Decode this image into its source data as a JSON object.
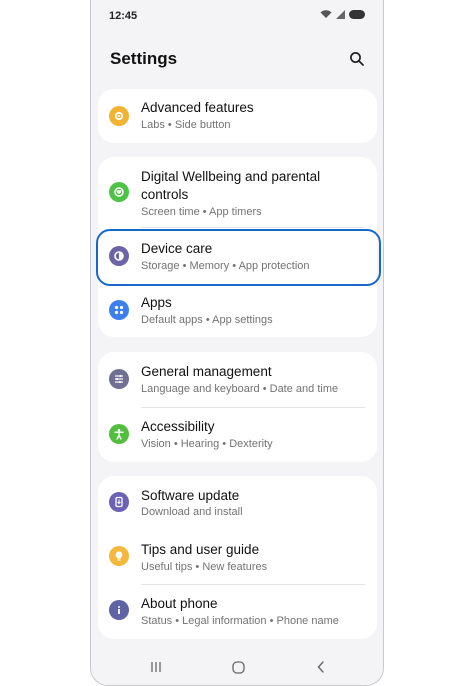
{
  "status": {
    "time": "12:45"
  },
  "header": {
    "title": "Settings"
  },
  "items": [
    {
      "title": "Advanced features",
      "subtitle": "Labs  •  Side button",
      "icon": "advanced-features-icon",
      "color": "#f2b233"
    },
    {
      "title": "Digital Wellbeing and parental controls",
      "subtitle": "Screen time  •  App timers",
      "icon": "wellbeing-icon",
      "color": "#4dc246"
    },
    {
      "title": "Device care",
      "subtitle": "Storage  •  Memory  •  App protection",
      "icon": "device-care-icon",
      "color": "#6d63a7"
    },
    {
      "title": "Apps",
      "subtitle": "Default apps  •  App settings",
      "icon": "apps-icon",
      "color": "#3e7ff0"
    },
    {
      "title": "General management",
      "subtitle": "Language and keyboard  •  Date and time",
      "icon": "general-management-icon",
      "color": "#6e6f93"
    },
    {
      "title": "Accessibility",
      "subtitle": "Vision  •  Hearing  •  Dexterity",
      "icon": "accessibility-icon",
      "color": "#53bd3e"
    },
    {
      "title": "Software update",
      "subtitle": "Download and install",
      "icon": "software-update-icon",
      "color": "#6b62b5"
    },
    {
      "title": "Tips and user guide",
      "subtitle": "Useful tips  •  New features",
      "icon": "tips-icon",
      "color": "#f4b83a"
    },
    {
      "title": "About phone",
      "subtitle": "Status  •  Legal information  •  Phone name",
      "icon": "info-icon",
      "color": "#5f63a3"
    }
  ],
  "highlight_color": "#1769c9"
}
